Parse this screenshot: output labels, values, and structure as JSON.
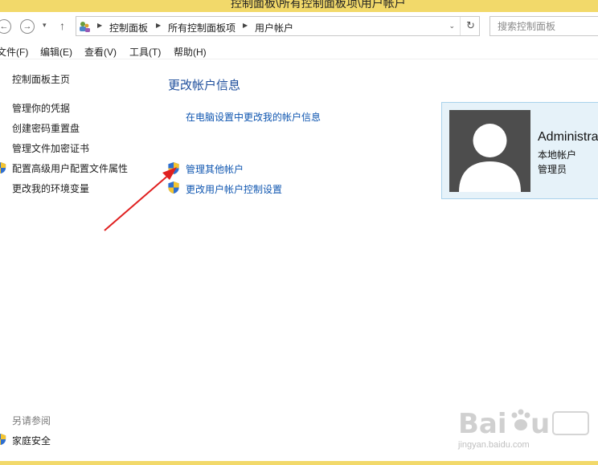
{
  "window": {
    "title": "控制面板\\所有控制面板项\\用户帐户"
  },
  "nav": {
    "back_glyph": "←",
    "forward_glyph": "→",
    "recent_glyph": "▾",
    "up_glyph": "↑"
  },
  "address": {
    "crumbs": [
      "控制面板",
      "所有控制面板项",
      "用户帐户"
    ],
    "sep_glyph": "▶",
    "drop_glyph": "⌄",
    "refresh_glyph": "↻"
  },
  "search": {
    "placeholder": "搜索控制面板"
  },
  "menu": {
    "file": "文件(F)",
    "edit": "编辑(E)",
    "view": "查看(V)",
    "tools": "工具(T)",
    "help": "帮助(H)"
  },
  "sidebar": {
    "home": "控制面板主页",
    "items": [
      "管理你的凭据",
      "创建密码重置盘",
      "管理文件加密证书",
      "配置高级用户配置文件属性",
      "更改我的环境变量"
    ],
    "see_also_label": "另请参阅",
    "see_also_items": [
      "家庭安全"
    ]
  },
  "main": {
    "title": "更改帐户信息",
    "pc_settings_link": "在电脑设置中更改我的帐户信息",
    "manage_other_link": "管理其他帐户",
    "uac_link": "更改用户帐户控制设置"
  },
  "account": {
    "name": "Administrator",
    "type": "本地帐户",
    "role": "管理员"
  },
  "watermark": {
    "url": "jingyan.baidu.com"
  },
  "icons": {
    "control_panel": "control-panel-icon",
    "shield": "uac-shield-icon",
    "avatar": "user-avatar-icon"
  },
  "colors": {
    "link": "#0f56b0",
    "title": "#1e4e9c",
    "title_bar": "#f2d96a",
    "card_bg": "#e6f2f9",
    "annotation_arrow": "#e02020"
  }
}
